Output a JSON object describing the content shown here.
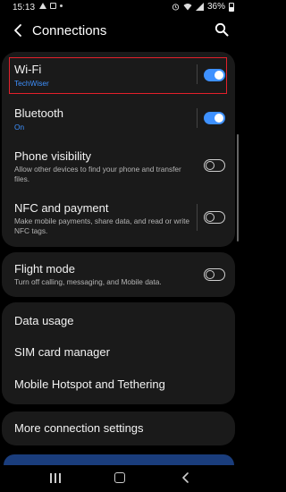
{
  "status": {
    "time": "15:13",
    "battery": "36%"
  },
  "header": {
    "title": "Connections"
  },
  "wifi": {
    "label": "Wi-Fi",
    "network": "TechWiser",
    "on": true
  },
  "bluetooth": {
    "label": "Bluetooth",
    "status": "On",
    "on": true
  },
  "phone_visibility": {
    "label": "Phone visibility",
    "description": "Allow other devices to find your phone and transfer files.",
    "on": false
  },
  "nfc": {
    "label": "NFC and payment",
    "description": "Make mobile payments, share data, and read or write NFC tags.",
    "on": false
  },
  "flight": {
    "label": "Flight mode",
    "description": "Turn off calling, messaging, and Mobile data.",
    "on": false
  },
  "menu": {
    "data_usage": "Data usage",
    "sim_manager": "SIM card manager",
    "hotspot": "Mobile Hotspot and Tethering"
  },
  "more": {
    "label": "More connection settings"
  },
  "colors": {
    "accent": "#3e91ff",
    "highlight": "#e3202b",
    "card": "#1a1a1a"
  }
}
